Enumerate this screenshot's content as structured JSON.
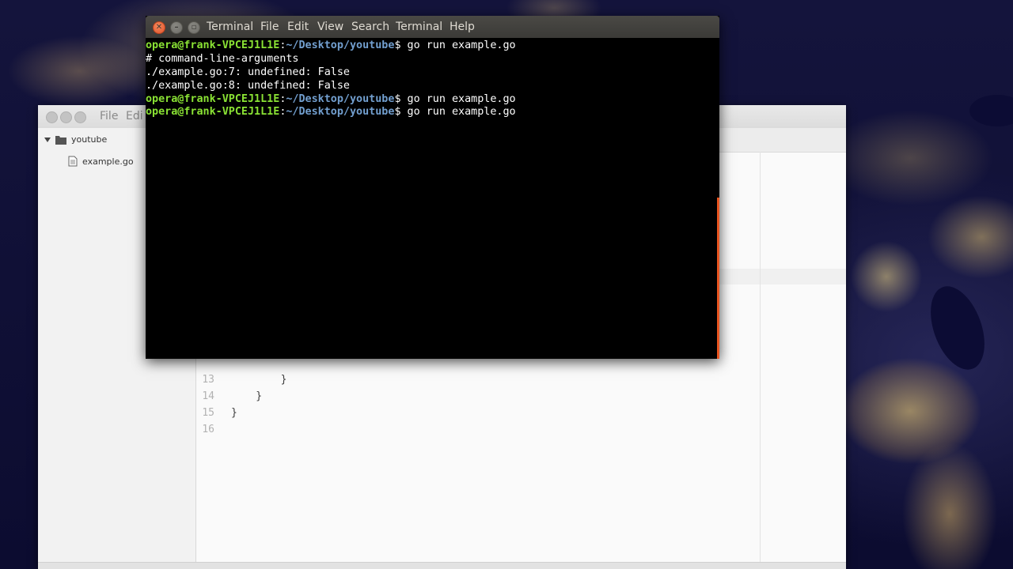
{
  "terminal": {
    "menu": [
      "Terminal",
      "File",
      "Edit",
      "View",
      "Search",
      "Terminal",
      "Help"
    ],
    "lines": [
      {
        "user": "opera@frank-VPCEJ1L1E",
        "path": "~/Desktop/youtube",
        "cmd": "$ go run example.go"
      },
      {
        "text": "# command-line-arguments"
      },
      {
        "text": "./example.go:7: undefined: False"
      },
      {
        "text": "./example.go:8: undefined: False"
      },
      {
        "user": "opera@frank-VPCEJ1L1E",
        "path": "~/Desktop/youtube",
        "cmd": "$ go run example.go"
      },
      {
        "user": "opera@frank-VPCEJ1L1E",
        "path": "~/Desktop/youtube",
        "cmd": "$ go run example.go"
      }
    ],
    "colors": {
      "prompt_user": "#8ae234",
      "prompt_path": "#729fcf",
      "accent": "#e95420"
    }
  },
  "editor": {
    "menu": [
      "File",
      "Edi"
    ],
    "sidebar": {
      "folder": "youtube",
      "file": "example.go"
    },
    "code": [
      {
        "ln": "13",
        "text": "        }"
      },
      {
        "ln": "14",
        "text": "    }"
      },
      {
        "ln": "15",
        "text": "}"
      },
      {
        "ln": "16",
        "text": ""
      }
    ]
  },
  "icons": {
    "folder": "folder-icon",
    "file": "file-icon",
    "expander": "chevron-down-icon"
  }
}
